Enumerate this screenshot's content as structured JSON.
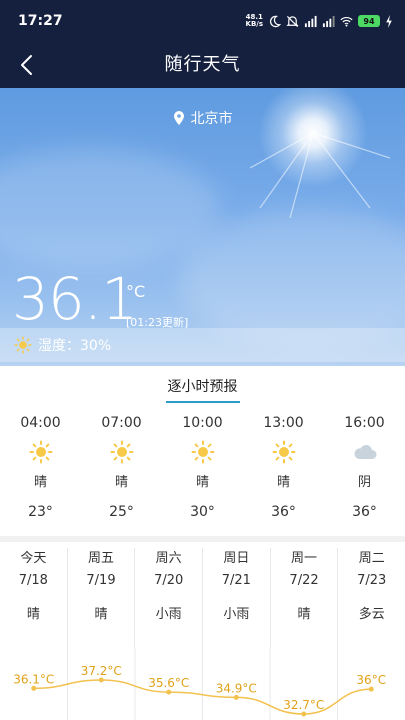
{
  "status": {
    "time": "17:27",
    "net_speed_value": "48.1",
    "net_speed_unit": "KB/s",
    "battery": "94"
  },
  "nav": {
    "title": "随行天气"
  },
  "current": {
    "location": "北京市",
    "temperature": "36.1",
    "unit": "°C",
    "update": "[01:23更新]",
    "humidity": "湿度：30%"
  },
  "hourly": {
    "title": "逐小时预报",
    "items": [
      {
        "time": "04:00",
        "cond": "晴",
        "temp": "23°",
        "icon": "sun-icon"
      },
      {
        "time": "07:00",
        "cond": "晴",
        "temp": "25°",
        "icon": "sun-icon"
      },
      {
        "time": "10:00",
        "cond": "晴",
        "temp": "30°",
        "icon": "sun-icon"
      },
      {
        "time": "13:00",
        "cond": "晴",
        "temp": "36°",
        "icon": "sun-icon"
      },
      {
        "time": "16:00",
        "cond": "阴",
        "temp": "36°",
        "icon": "cloud-icon"
      }
    ]
  },
  "daily": {
    "items": [
      {
        "day": "今天",
        "date": "7/18",
        "cond": "晴",
        "high": "36.1°C",
        "high_value": 36.1
      },
      {
        "day": "周五",
        "date": "7/19",
        "cond": "晴",
        "high": "37.2°C",
        "high_value": 37.2
      },
      {
        "day": "周六",
        "date": "7/20",
        "cond": "小雨",
        "high": "35.6°C",
        "high_value": 35.6
      },
      {
        "day": "周日",
        "date": "7/21",
        "cond": "小雨",
        "high": "34.9°C",
        "high_value": 34.9
      },
      {
        "day": "周一",
        "date": "7/22",
        "cond": "晴",
        "high": "32.7°C",
        "high_value": 32.7
      },
      {
        "day": "周二",
        "date": "7/23",
        "cond": "多云",
        "high": "36°C",
        "high_value": 36
      }
    ]
  },
  "colors": {
    "header_bg": "#15203f",
    "accent": "#2f9bc9",
    "sun": "#f7c948",
    "chart_line": "#f2c14e",
    "chart_text": "#e0a21a"
  }
}
